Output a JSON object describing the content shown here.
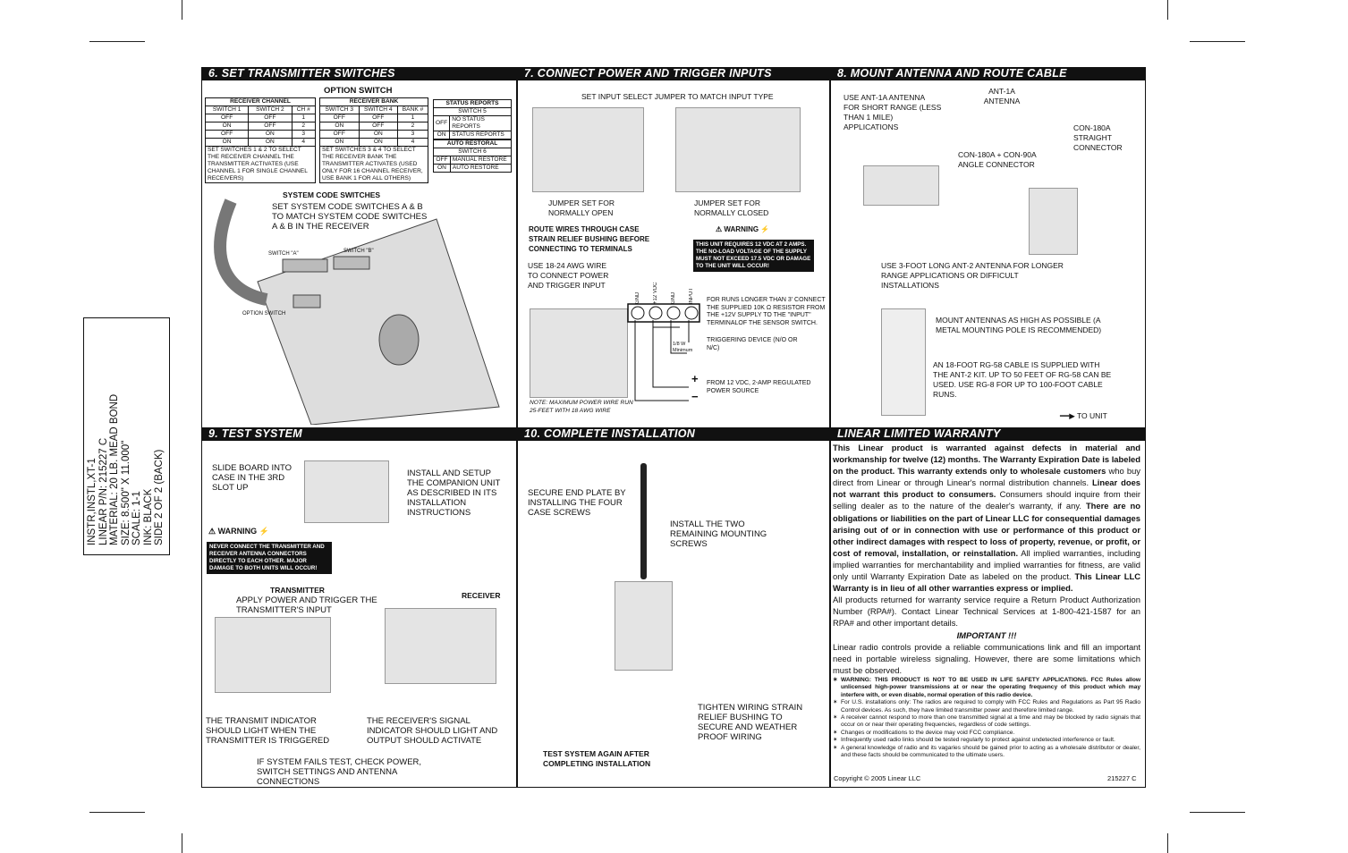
{
  "sidebar": {
    "lines": [
      "INSTR,INSTL,XT-1",
      "LINEAR P/N: 215227 C",
      "MATERIAL: 20 LB. MEAD BOND",
      "SIZE: 8.500\" X 11.000\"",
      "SCALE: 1-1",
      "INK: BLACK",
      "SIDE 2 OF 2 (BACK)"
    ]
  },
  "sections": {
    "s6": "6.   SET TRANSMITTER SWITCHES",
    "s7": "7.   CONNECT POWER AND TRIGGER INPUTS",
    "s8": "8.   MOUNT ANTENNA AND ROUTE CABLE",
    "s9": "9.   TEST SYSTEM",
    "s10": "10. COMPLETE INSTALLATION",
    "warranty": "LINEAR LIMITED WARRANTY"
  },
  "s6": {
    "option_switch": "OPTION SWITCH",
    "receiver_channel": {
      "title": "RECEIVER CHANNEL",
      "headers": [
        "SWITCH 1",
        "SWITCH 2",
        "CH #"
      ],
      "rows": [
        [
          "OFF",
          "OFF",
          "1"
        ],
        [
          "ON",
          "OFF",
          "2"
        ],
        [
          "OFF",
          "ON",
          "3"
        ],
        [
          "ON",
          "ON",
          "4"
        ]
      ],
      "note": "SET SWITCHES 1 & 2 TO SELECT THE RECEIVER CHANNEL THE TRANSMITTER ACTIVATES (USE CHANNEL 1 FOR SINGLE CHANNEL RECEIVERS)"
    },
    "receiver_bank": {
      "title": "RECEIVER BANK",
      "headers": [
        "SWITCH 3",
        "SWITCH 4",
        "BANK #"
      ],
      "rows": [
        [
          "OFF",
          "OFF",
          "1"
        ],
        [
          "ON",
          "OFF",
          "2"
        ],
        [
          "OFF",
          "ON",
          "3"
        ],
        [
          "ON",
          "ON",
          "4"
        ]
      ],
      "note": "SET SWITCHES 3 & 4 TO SELECT THE RECEIVER BANK THE TRANSMITTER ACTIVATES (USED ONLY FOR 16 CHANNEL RECEIVER, USE BANK 1 FOR ALL OTHERS)"
    },
    "status_reports": {
      "title": "STATUS REPORTS",
      "switch": "SWITCH 5",
      "rows": [
        [
          "OFF",
          "NO STATUS REPORTS"
        ],
        [
          "ON",
          "STATUS REPORTS"
        ]
      ]
    },
    "auto_restoral": {
      "title": "AUTO RESTORAL",
      "switch": "SWITCH 6",
      "rows": [
        [
          "OFF",
          "MANUAL RESTORE"
        ],
        [
          "ON",
          "AUTO RESTORE"
        ]
      ]
    },
    "system_code_title": "SYSTEM CODE SWITCHES",
    "system_code_text": "SET SYSTEM CODE SWITCHES A & B TO MATCH SYSTEM CODE SWITCHES A & B IN THE RECEIVER",
    "switch_a": "SWITCH \"A\"",
    "switch_b": "SWITCH \"B\"",
    "option_switch_label": "OPTION SWITCH"
  },
  "s7": {
    "jumper_title": "SET INPUT SELECT JUMPER TO MATCH INPUT TYPE",
    "jumper_open": "JUMPER SET FOR NORMALLY OPEN",
    "jumper_closed": "JUMPER SET FOR NORMALLY CLOSED",
    "route": "ROUTE WIRES THROUGH CASE STRAIN RELIEF BUSHING BEFORE CONNECTING TO TERMINALS",
    "warning": "WARNING",
    "warning_text": "THIS UNIT REQUIRES 12 VDC AT 2 AMPS. THE NO-LOAD VOLTAGE OF THE SUPPLY MUST NOT EXCEED 17.5 VDC OR DAMAGE TO THE UNIT WILL OCCUR!",
    "awg": "USE 18-24 AWG WIRE TO CONNECT POWER AND TRIGGER INPUT",
    "terminals": [
      "GND",
      "+12 VDC",
      "GND",
      "INPUT"
    ],
    "resistor_note": "FOR RUNS LONGER THAN 3' CONNECT THE SUPPLIED 10K Ω RESISTOR FROM THE +12V SUPPLY TO THE \"INPUT\" TERMINALOF THE SENSOR SWITCH.",
    "resistor_rating": "1/8 W Minimum",
    "trigger": "TRIGGERING DEVICE (N/O OR N/C)",
    "power": "FROM 12 VDC, 2-AMP REGULATED POWER SOURCE",
    "plus": "+",
    "minus": "−",
    "note": "NOTE: MAXIMUM POWER WIRE RUN 25-FEET WITH 18 AWG WIRE"
  },
  "s8": {
    "ant1a_use": "USE ANT-1A ANTENNA FOR SHORT RANGE (LESS THAN 1 MILE) APPLICATIONS",
    "ant1a": "ANT-1A ANTENNA",
    "con180a": "CON-180A STRAIGHT CONNECTOR",
    "angle": "CON-180A + CON-90A ANGLE CONNECTOR",
    "ant2": "USE 3-FOOT LONG ANT-2 ANTENNA FOR LONGER RANGE APPLICATIONS OR DIFFICULT INSTALLATIONS",
    "mount": "MOUNT ANTENNAS AS HIGH AS POSSIBLE (A METAL MOUNTING POLE IS RECOMMENDED)",
    "cable": "AN 18-FOOT RG-58 CABLE IS SUPPLIED WITH THE ANT-2 KIT. UP TO 50 FEET OF RG-58 CAN BE USED. USE RG-8 FOR UP TO 100-FOOT CABLE RUNS.",
    "to_unit": "TO UNIT"
  },
  "s9": {
    "slide": "SLIDE BOARD INTO CASE IN THE 3RD SLOT UP",
    "install": "INSTALL AND SETUP THE COMPANION UNIT AS DESCRIBED IN ITS INSTALLATION INSTRUCTIONS",
    "warning": "WARNING",
    "warning_text": "NEVER CONNECT THE TRANSMITTER AND RECEIVER ANTENNA CONNECTORS DIRECTLY TO EACH OTHER. MAJOR DAMAGE TO BOTH UNITS WILL OCCUR!",
    "transmitter": "TRANSMITTER",
    "receiver": "RECEIVER",
    "apply": "APPLY POWER AND TRIGGER THE TRANSMITTER'S INPUT",
    "tx_indicator": "THE TRANSMIT INDICATOR SHOULD LIGHT WHEN THE TRANSMITTER IS TRIGGERED",
    "rx_indicator": "THE RECEIVER'S SIGNAL INDICATOR SHOULD LIGHT AND OUTPUT SHOULD ACTIVATE",
    "fails": "IF SYSTEM FAILS TEST, CHECK POWER, SWITCH SETTINGS AND ANTENNA CONNECTIONS"
  },
  "s10": {
    "secure": "SECURE END PLATE BY INSTALLING THE FOUR CASE SCREWS",
    "install_screws": "INSTALL THE TWO REMAINING MOUNTING SCREWS",
    "tighten": "TIGHTEN WIRING STRAIN RELIEF BUSHING TO SECURE AND WEATHER PROOF WIRING",
    "test_again": "TEST SYSTEM AGAIN AFTER COMPLETING INSTALLATION"
  },
  "warranty": {
    "p1": [
      {
        "b": true,
        "t": "This Linear product is warranted against defects in material and workmanship for twelve (12) months. The Warranty Expiration Date is labeled on the product. This warranty extends only to wholesale customers"
      },
      {
        "b": false,
        "t": " who buy direct from Linear or through Linear's normal distribution channels. "
      },
      {
        "b": true,
        "t": "Linear does not warrant this product to consumers."
      },
      {
        "b": false,
        "t": " Consumers should inquire from their selling dealer as to the nature of the dealer's warranty, if any. "
      },
      {
        "b": true,
        "t": "There are no obligations or liabilities on the part of Linear LLC for consequential damages arising out of or in connection with use or performance of this product or other indirect damages with respect to loss of property, revenue, or profit, or cost of removal, installation, or reinstallation."
      },
      {
        "b": false,
        "t": " All implied warranties, including implied warranties for merchantability and implied warranties for fitness, are valid only until Warranty Expiration Date as labeled on the product. "
      },
      {
        "b": true,
        "t": "This Linear LLC Warranty is in lieu of all other warranties express or implied."
      }
    ],
    "p2": "All products returned for warranty service require a Return Product Authorization Number (RPA#). Contact Linear Technical Services at 1-800-421-1587 for an RPA# and other important details.",
    "important": "IMPORTANT !!!",
    "p3": "Linear radio controls provide a reliable communications link and fill an important need in portable wireless signaling. However, there are some limitations which must be observed.",
    "bullets": [
      "WARNING: THIS PRODUCT IS NOT TO BE USED IN LIFE SAFETY APPLICATIONS. FCC Rules allow unlicensed high-power transmissions at or near the operating frequency of this product which may interfere with, or even disable, normal operation of this radio device.",
      "For U.S. installations only: The radios are required to comply with FCC Rules and Regulations as Part 95 Radio Control devices. As such, they have limited transmitter power and therefore limited range.",
      "A receiver cannot respond to more than one transmitted signal at a time and may be blocked by radio signals that occur on or near their operating frequencies, regardless of code settings.",
      "Changes or modifications to the device may void FCC compliance.",
      "Infrequently used radio links should be tested regularly to protect against undetected interference or fault.",
      "A general knowledge of radio and its vagaries should be gained prior to acting as a wholesale distributor or dealer, and these facts should be communicated to the ultimate users."
    ],
    "copyright": "Copyright © 2005 Linear LLC",
    "part": "215227 C"
  }
}
